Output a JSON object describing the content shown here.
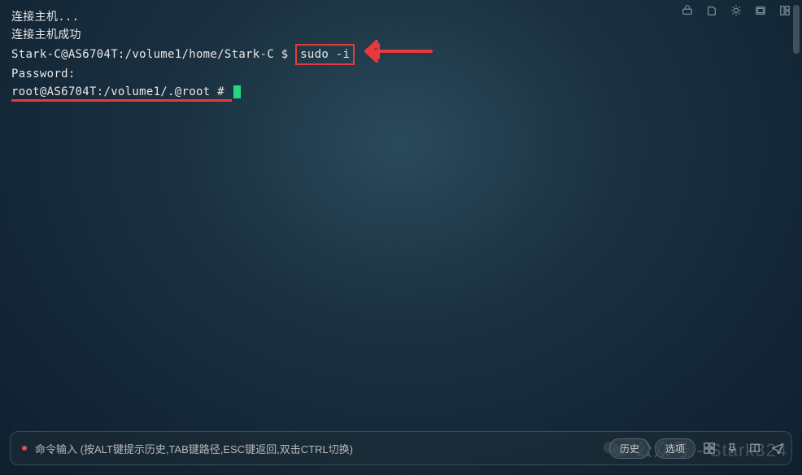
{
  "terminal": {
    "line1": "连接主机...",
    "line2": "连接主机成功",
    "prompt1_user": "Stark-C@AS6704T:/volume1/home/Stark-C $ ",
    "command": "sudo -i",
    "line4": "Password:",
    "prompt2": "root@AS6704T:/volume1/.@root # "
  },
  "bottombar": {
    "placeholder": "命令输入 (按ALT键提示历史,TAB键路径,ESC键返回,双击CTRL切换)",
    "history_btn": "历史",
    "options_btn": "选项"
  },
  "watermark": {
    "text": "公众号 - Stark324"
  },
  "colors": {
    "accent_red": "#e83a3a",
    "cursor_green": "#26d97f"
  }
}
